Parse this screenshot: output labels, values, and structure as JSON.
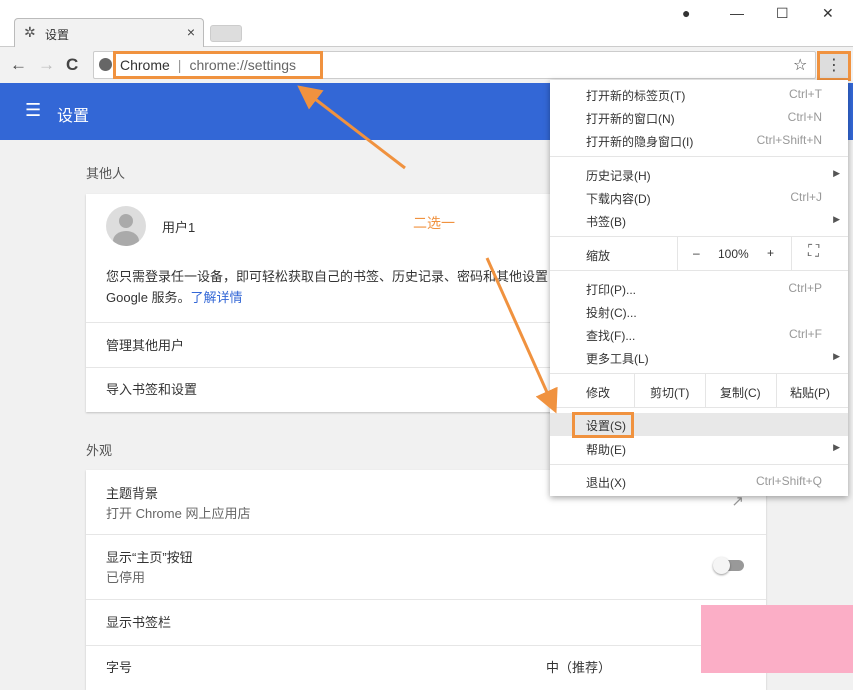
{
  "tab": {
    "title": "设置",
    "close": "×",
    "icon": "gear-icon"
  },
  "window": {
    "profile": "●",
    "minimize": "—",
    "maximize": "☐",
    "close": "✕"
  },
  "toolbar": {
    "back": "←",
    "forward": "→",
    "reload": "C",
    "site": "Chrome",
    "separator": "|",
    "url": "chrome://settings",
    "star": "☆",
    "menu": "⋮"
  },
  "header": {
    "menu_icon": "☰",
    "title": "设置"
  },
  "sections": [
    {
      "label": "其他人"
    },
    {
      "label": "外观"
    }
  ],
  "people": {
    "user": "用户1",
    "desc_line1": "您只需登录任一设备，即可轻松获取自己的书签、历史记录、密码和其他设置",
    "desc_line2": "Google 服务。",
    "learn_more": "了解详情",
    "manage": "管理其他用户",
    "import": "导入书签和设置"
  },
  "appearance": {
    "theme": "主题背景",
    "theme_sub": "打开 Chrome 网上应用店",
    "home": "显示“主页”按钮",
    "home_sub": "已停用",
    "home_enabled": false,
    "bookmarks_bar": "显示书签栏",
    "font_size": "字号",
    "font_size_value": "中（推荐）"
  },
  "menu": {
    "items": [
      {
        "label": "打开新的标签页(T)",
        "shortcut": "Ctrl+T"
      },
      {
        "label": "打开新的窗口(N)",
        "shortcut": "Ctrl+N"
      },
      {
        "label": "打开新的隐身窗口(I)",
        "shortcut": "Ctrl+Shift+N"
      },
      {
        "label": "历史记录(H)",
        "shortcut": ""
      },
      {
        "label": "下载内容(D)",
        "shortcut": "Ctrl+J"
      },
      {
        "label": "书签(B)",
        "shortcut": ""
      },
      {
        "label": "打印(P)...",
        "shortcut": "Ctrl+P"
      },
      {
        "label": "投射(C)...",
        "shortcut": ""
      },
      {
        "label": "查找(F)...",
        "shortcut": "Ctrl+F"
      },
      {
        "label": "更多工具(L)",
        "shortcut": ""
      },
      {
        "label": "设置(S)",
        "shortcut": ""
      },
      {
        "label": "帮助(E)",
        "shortcut": ""
      },
      {
        "label": "退出(X)",
        "shortcut": "Ctrl+Shift+Q"
      }
    ],
    "zoom": {
      "label": "缩放",
      "minus": "–",
      "value": "100%",
      "plus": "+",
      "fullscreen": "⛶"
    },
    "edit": {
      "label": "修改",
      "cut": "剪切(T)",
      "copy": "复制(C)",
      "paste": "粘贴(P)"
    },
    "submenu_arrow": "▶"
  },
  "annotation": {
    "text": "二选一",
    "color": "#f0923f"
  },
  "colors": {
    "accent": "#3367d6",
    "highlight": "#f0923f"
  }
}
